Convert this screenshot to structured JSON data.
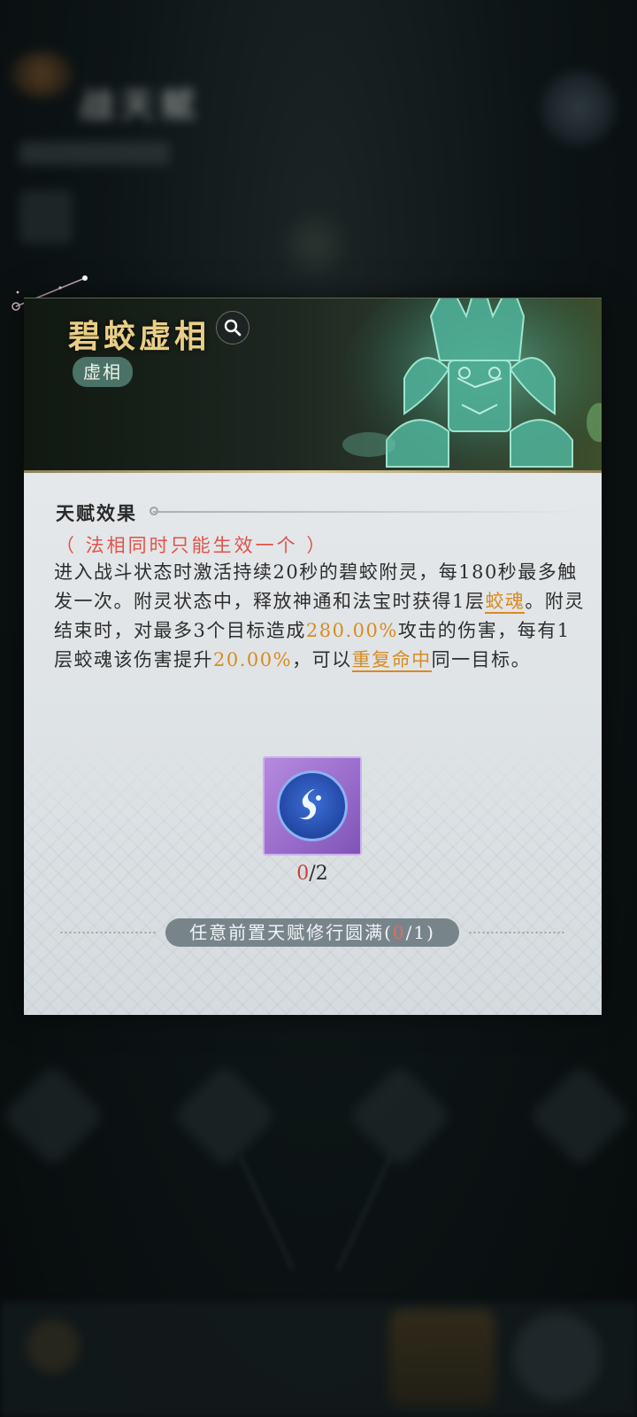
{
  "background": {
    "title": "战天赋"
  },
  "talent": {
    "name": "碧蛟虚相",
    "tag": "虚相",
    "section_title": "天赋效果",
    "note": "（ 法相同时只能生效一个 ）",
    "desc": {
      "p1": "进入战斗状态时激活持续20秒的碧蛟附灵，每180秒最多触发一次。附灵状态中，释放神通和法宝时获得1层",
      "link1": "蛟魂",
      "p2": "。附灵结束时，对最多3个目标造成",
      "val1": "280.00%",
      "p3": "攻击的伤害，每有1层蛟魂该伤害提升",
      "val2": "20.00%",
      "p4": "，可以",
      "link2": "重复命中",
      "p5": "同一目标。"
    },
    "progress": {
      "current": "0",
      "total": "/2"
    },
    "requirement": {
      "label": "任意前置天赋修行圆满(",
      "current": "0",
      "rest": "/1)"
    }
  },
  "colors": {
    "title_gold": "#e9cf86",
    "tag_green": "#4a7266",
    "note_red": "#e0534a",
    "highlight_orange": "#d98b1f",
    "item_purple": "#9a6dcc"
  },
  "icons": [
    "search-icon",
    "soul-orb-icon",
    "constellation-icon"
  ]
}
